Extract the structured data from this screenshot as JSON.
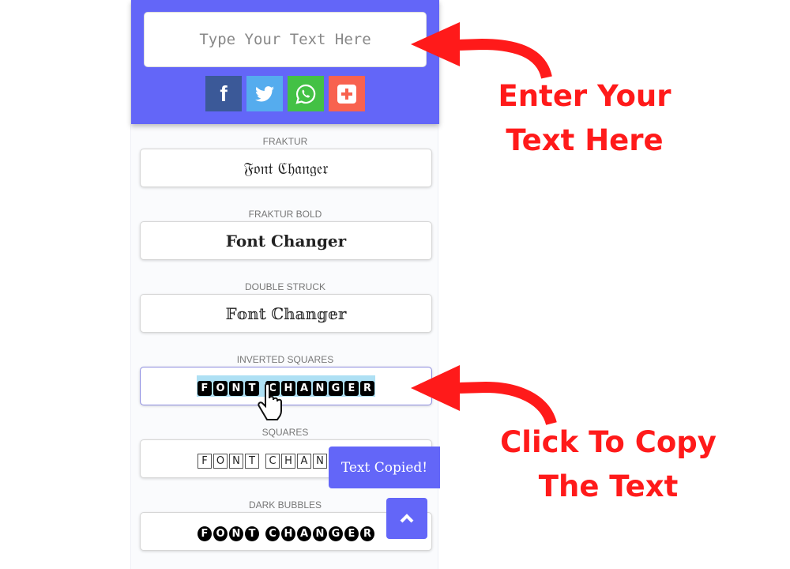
{
  "input": {
    "placeholder": "Type Your Text Here"
  },
  "share": [
    {
      "name": "facebook",
      "color": "#3b5998"
    },
    {
      "name": "twitter",
      "color": "#55acee"
    },
    {
      "name": "whatsapp",
      "color": "#43c145"
    },
    {
      "name": "more",
      "color": "#f8624f"
    }
  ],
  "styles": [
    {
      "label": "FRAKTUR",
      "text": "𝔉𝔬𝔫𝔱 ℭ𝔥𝔞𝔫𝔤𝔢𝔯"
    },
    {
      "label": "FRAKTUR BOLD",
      "text": "�::Font Changer"
    },
    {
      "label": "DOUBLE STRUCK",
      "text": "𝔽𝕠𝕟𝕥 ℂ𝕙𝕒𝕟𝕘𝕖𝕣"
    },
    {
      "label": "INVERTED SQUARES",
      "text": "FONT CHANGER"
    },
    {
      "label": "SQUARES",
      "text": "FONT CHAN"
    },
    {
      "label": "DARK BUBBLES",
      "text": "FONT CHANGER"
    }
  ],
  "toast": "Text Copied!",
  "annotations": {
    "top": [
      "Enter Your",
      "Text Here"
    ],
    "bottom": [
      "Click To Copy",
      "The Text"
    ]
  },
  "accent": "#6366f8",
  "annotation_color": "#ff1a1a"
}
